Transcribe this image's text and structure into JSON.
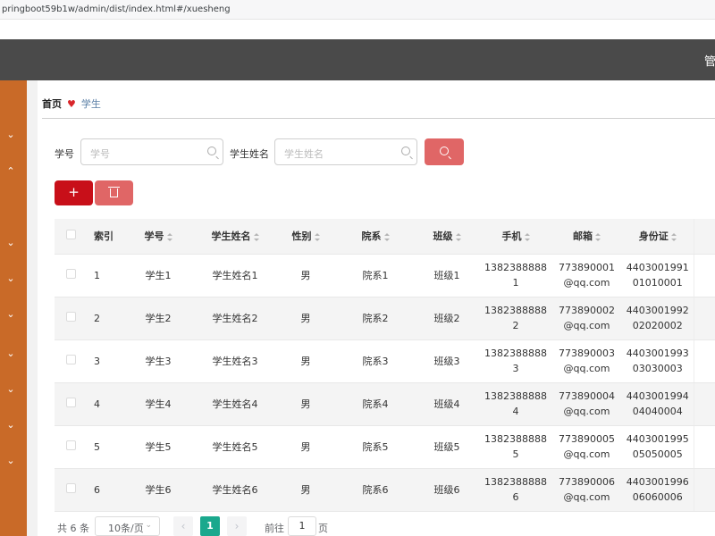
{
  "browser": {
    "url": "pringboot59b1w/admin/dist/index.html#/xuesheng"
  },
  "header": {
    "user_partial": "管"
  },
  "sidebar": {
    "chevrons": [
      "⌄",
      "⌃",
      "⌄",
      "⌄",
      "⌄",
      "⌄",
      "⌄",
      "⌄",
      "⌄"
    ]
  },
  "breadcrumb": {
    "home": "首页",
    "heart": "♥",
    "current": "学生"
  },
  "search": {
    "label_id": "学号",
    "placeholder_id": "学号",
    "label_name": "学生姓名",
    "placeholder_name": "学生姓名"
  },
  "toolbar": {
    "add_label": "+"
  },
  "table": {
    "columns": [
      "索引",
      "学号",
      "学生姓名",
      "性别",
      "院系",
      "班级",
      "手机",
      "邮箱",
      "身份证"
    ],
    "rows": [
      {
        "index": "1",
        "id": "学生1",
        "name": "学生姓名1",
        "gender": "男",
        "dept": "院系1",
        "class": "班级1",
        "phone": [
          "1382388888",
          "1"
        ],
        "email": [
          "773890001",
          "@qq.com"
        ],
        "idcard": [
          "4403001991",
          "01010001"
        ]
      },
      {
        "index": "2",
        "id": "学生2",
        "name": "学生姓名2",
        "gender": "男",
        "dept": "院系2",
        "class": "班级2",
        "phone": [
          "1382388888",
          "2"
        ],
        "email": [
          "773890002",
          "@qq.com"
        ],
        "idcard": [
          "4403001992",
          "02020002"
        ]
      },
      {
        "index": "3",
        "id": "学生3",
        "name": "学生姓名3",
        "gender": "男",
        "dept": "院系3",
        "class": "班级3",
        "phone": [
          "1382388888",
          "3"
        ],
        "email": [
          "773890003",
          "@qq.com"
        ],
        "idcard": [
          "4403001993",
          "03030003"
        ]
      },
      {
        "index": "4",
        "id": "学生4",
        "name": "学生姓名4",
        "gender": "男",
        "dept": "院系4",
        "class": "班级4",
        "phone": [
          "1382388888",
          "4"
        ],
        "email": [
          "773890004",
          "@qq.com"
        ],
        "idcard": [
          "4403001994",
          "04040004"
        ]
      },
      {
        "index": "5",
        "id": "学生5",
        "name": "学生姓名5",
        "gender": "男",
        "dept": "院系5",
        "class": "班级5",
        "phone": [
          "1382388888",
          "5"
        ],
        "email": [
          "773890005",
          "@qq.com"
        ],
        "idcard": [
          "4403001995",
          "05050005"
        ]
      },
      {
        "index": "6",
        "id": "学生6",
        "name": "学生姓名6",
        "gender": "男",
        "dept": "院系6",
        "class": "班级6",
        "phone": [
          "1382388888",
          "6"
        ],
        "email": [
          "773890006",
          "@qq.com"
        ],
        "idcard": [
          "4403001996",
          "06060006"
        ]
      }
    ]
  },
  "pagination": {
    "total": "共 6 条",
    "page_size": "10条/页",
    "current_page": "1",
    "goto_label": "前往",
    "goto_value": "1",
    "goto_unit": "页",
    "prev": "‹",
    "next": "›",
    "dropdown": "⌄"
  },
  "colors": {
    "sidebar": "#c96a28",
    "header": "#4a4a4a",
    "accent_red": "#c80f19",
    "accent_light_red": "#e06666",
    "page_active": "#1aa88d"
  }
}
